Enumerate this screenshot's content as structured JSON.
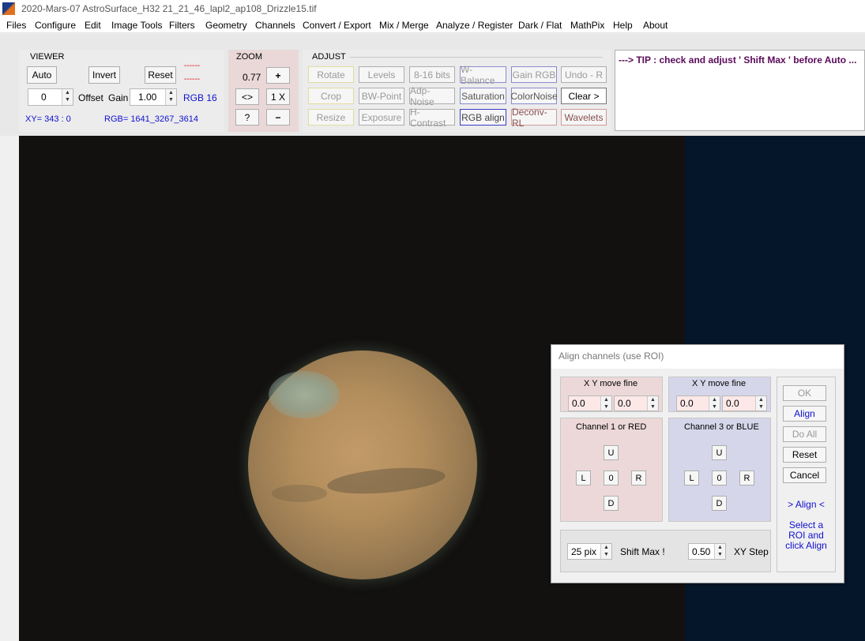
{
  "window": {
    "title": "2020-Mars-07  AstroSurface_H32    21_21_46_lapl2_ap108_Drizzle15.tif"
  },
  "menu": [
    "Files",
    "Configure",
    "Edit",
    "Image Tools",
    "Filters",
    "Geometry",
    "Channels",
    "Convert / Export",
    "Mix / Merge",
    "Analyze / Register",
    "Dark / Flat",
    "MathPix",
    "Help",
    "About"
  ],
  "viewer": {
    "label": "VIEWER",
    "auto": "Auto",
    "invert": "Invert",
    "reset": "Reset",
    "dashes1": "------",
    "dashes2": "------",
    "offset_value": "0",
    "offset_label": "Offset",
    "gain_label": "Gain",
    "gain_value": "1.00",
    "rgb_mode": "RGB 16",
    "xy": "XY=  343 : 0",
    "rgb": "RGB=  1641_3267_3614"
  },
  "zoom": {
    "label": "ZOOM",
    "value": "0.77",
    "plus": "+",
    "fit": "<>",
    "one": "1 X",
    "help": "?",
    "minus": "−"
  },
  "adjust": {
    "label": "ADJUST",
    "buttons": [
      [
        "Rotate",
        "Levels",
        "8-16 bits",
        "W-Balance",
        "Gain RGB",
        "Undo - R"
      ],
      [
        "Crop",
        "BW-Point",
        "Adp-Noise",
        "Saturation",
        "ColorNoise",
        "Clear >"
      ],
      [
        "Resize",
        "Exposure",
        "H-Contrast",
        "RGB align",
        "Deconv-RL",
        "Wavelets"
      ]
    ]
  },
  "tip": "---> TIP :  check and adjust  ' Shift Max '  before Auto ...",
  "dialog": {
    "title": "Align channels (use ROI)",
    "left": {
      "header": "X  Y  move fine",
      "x": "0.0",
      "y": "0.0",
      "channel": "Channel 1 or RED",
      "u": "U",
      "l": "L",
      "zero": "0",
      "r": "R",
      "d": "D"
    },
    "right": {
      "header": "X  Y  move fine",
      "x": "0.0",
      "y": "0.0",
      "channel": "Channel 3 or BLUE",
      "u": "U",
      "l": "L",
      "zero": "0",
      "r": "R",
      "d": "D"
    },
    "ok": "OK",
    "align": "Align",
    "do_all": "Do All",
    "reset": "Reset",
    "cancel": "Cancel",
    "align_marker": "> Align <",
    "hint": "Select a ROI and click Align",
    "shift_value": "25 pix",
    "shift_label": "Shift Max !",
    "step_value": "0.50",
    "step_label": "XY Step"
  }
}
